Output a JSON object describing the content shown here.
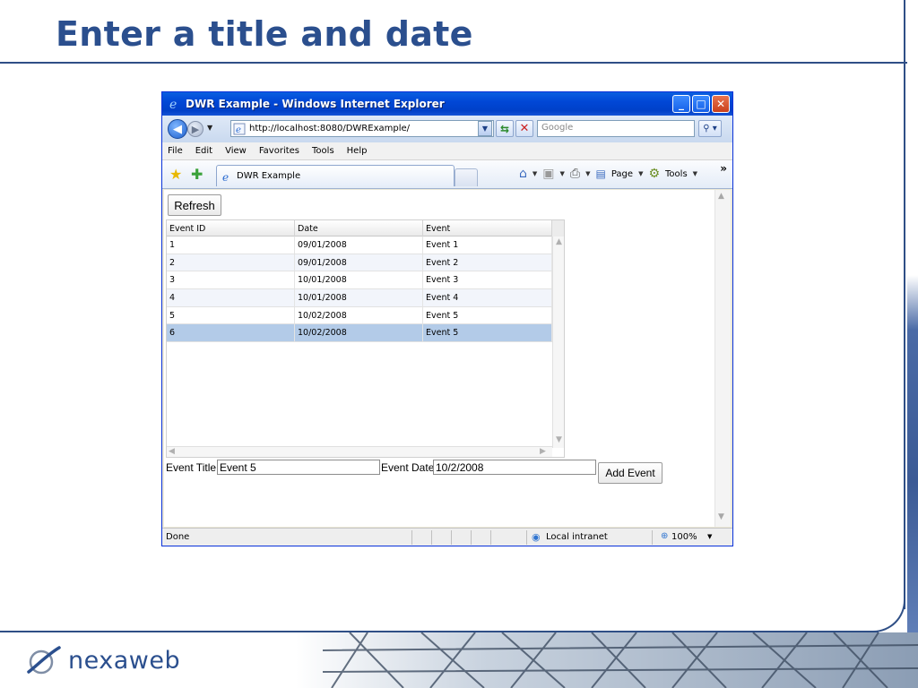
{
  "slide": {
    "title": "Enter a title and date",
    "logo_text": "nexaweb"
  },
  "window": {
    "title": "DWR Example - Windows Internet Explorer",
    "controls": {
      "minimize": "_",
      "maximize": "□",
      "close": "✕"
    }
  },
  "address_bar": {
    "url": "http://localhost:8080/DWRExample/",
    "search_placeholder": "Google"
  },
  "menu": {
    "items": [
      "File",
      "Edit",
      "View",
      "Favorites",
      "Tools",
      "Help"
    ]
  },
  "command_bar": {
    "tab_label": "DWR Example",
    "page_label": "Page",
    "tools_label": "Tools",
    "more": "»"
  },
  "page": {
    "refresh_label": "Refresh",
    "grid": {
      "columns": [
        "Event ID",
        "Date",
        "Event"
      ],
      "rows": [
        [
          "1",
          "09/01/2008",
          "Event 1"
        ],
        [
          "2",
          "09/01/2008",
          "Event 2"
        ],
        [
          "3",
          "10/01/2008",
          "Event 3"
        ],
        [
          "4",
          "10/01/2008",
          "Event 4"
        ],
        [
          "5",
          "10/02/2008",
          "Event 5"
        ],
        [
          "6",
          "10/02/2008",
          "Event 5"
        ]
      ],
      "selected_row": 5
    },
    "form": {
      "title_label": "Event Title:",
      "title_value": "Event 5",
      "date_label": "Event Date:",
      "date_value": "10/2/2008",
      "add_label": "Add Event"
    }
  },
  "status_bar": {
    "text": "Done",
    "zone": "Local intranet",
    "zoom": "100%"
  },
  "colors": {
    "slide_accent": "#2b4f8e",
    "titlebar": "#0147d6",
    "selected_row": "#b3cbe8"
  }
}
